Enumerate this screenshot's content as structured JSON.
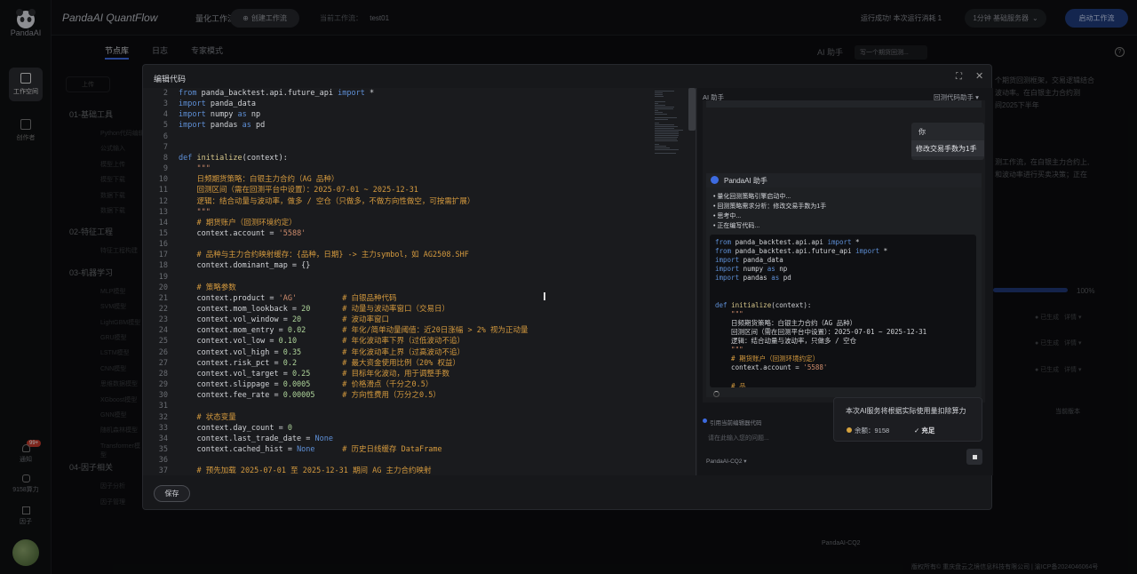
{
  "app": {
    "logo_text": "PandaAI",
    "brand": "PandaAI QuantFlow",
    "section_title": "量化工作流",
    "create_button": "创建工作流",
    "workflow_label": "当前工作流：",
    "workflow_name": "test01",
    "run_status": "运行成功! 本次运行消耗 1",
    "server": "1分钟 基础服务器",
    "start_button": "启动工作流"
  },
  "rail": {
    "workspace": "工作空间",
    "creator": "创作者",
    "notify": "通知",
    "notify_badge": "99+",
    "compute": "9158算力",
    "factor": "因子"
  },
  "tabs": [
    "节点库",
    "日志",
    "专家模式"
  ],
  "bg_side": {
    "upload": "上传",
    "groups": [
      {
        "label": "01-基础工具",
        "items": [
          "Python代码编辑",
          "公式输入",
          "模型上传",
          "模型下载",
          "数据下载",
          "数据下载"
        ]
      },
      {
        "label": "02-特征工程",
        "items": [
          "特征工程构建"
        ]
      },
      {
        "label": "03-机器学习",
        "items": [
          "MLP模型",
          "SVM模型",
          "LightGBM模型",
          "GRU模型",
          "LSTM模型",
          "CNN模型",
          "思维数据模型",
          "XGboost模型",
          "GNN模型",
          "随机森林模型",
          "Transformer模型"
        ]
      },
      {
        "label": "04-因子相关",
        "items": [
          "因子分析",
          "因子管理"
        ]
      }
    ]
  },
  "bg_right": {
    "ai_title": "AI 助手",
    "ai_tab": "写一个期货回测...",
    "lines": [
      "个期货回测框架，交易逻辑结合",
      "波动率。在白银主力合约测",
      "间2025下半年"
    ],
    "lines2": [
      "测工作流，在白银主力合约上,",
      "和波动率进行买卖决策；正在"
    ],
    "progress": "100%",
    "statuses": [
      "已生成",
      "已生成",
      "已生成"
    ],
    "details": "详情",
    "version_btn": "当前版本",
    "model_tab": "PandaAI-CQ2",
    "footer": "版权所有© 重庆盘云之境信息科技有限公司 | 渝ICP备2024046064号"
  },
  "modal": {
    "title": "编辑代码",
    "save": "保存",
    "code": [
      {
        "n": 2,
        "t": [
          [
            "kw",
            "from "
          ],
          [
            "tx",
            "panda_backtest.api.future_api "
          ],
          [
            "kw",
            "import "
          ],
          [
            "tx",
            "*"
          ]
        ]
      },
      {
        "n": 3,
        "t": [
          [
            "kw",
            "import "
          ],
          [
            "tx",
            "panda_data"
          ]
        ]
      },
      {
        "n": 4,
        "t": [
          [
            "kw",
            "import "
          ],
          [
            "tx",
            "numpy "
          ],
          [
            "kw",
            "as "
          ],
          [
            "tx",
            "np"
          ]
        ]
      },
      {
        "n": 5,
        "t": [
          [
            "kw",
            "import "
          ],
          [
            "tx",
            "pandas "
          ],
          [
            "kw",
            "as "
          ],
          [
            "tx",
            "pd"
          ]
        ]
      },
      {
        "n": 6,
        "t": []
      },
      {
        "n": 7,
        "t": []
      },
      {
        "n": 8,
        "t": [
          [
            "kw",
            "def "
          ],
          [
            "fn",
            "initialize"
          ],
          [
            "tx",
            "(context):"
          ]
        ]
      },
      {
        "n": 9,
        "t": [
          [
            "st",
            "    \"\"\""
          ]
        ]
      },
      {
        "n": 10,
        "t": [
          [
            "cm",
            "    日频期货策略：白银主力合约（AG 品种）"
          ]
        ]
      },
      {
        "n": 11,
        "t": [
          [
            "cm",
            "    回测区间（需在回测平台中设置）：2025-07-01 ~ 2025-12-31"
          ]
        ]
      },
      {
        "n": 12,
        "t": [
          [
            "cm",
            "    逻辑：结合动量与波动率，做多 / 空仓（只做多，不做方向性做空，可按需扩展）"
          ]
        ]
      },
      {
        "n": 13,
        "t": [
          [
            "st",
            "    \"\"\""
          ]
        ]
      },
      {
        "n": 14,
        "t": [
          [
            "cm",
            "    # 期货账户（回测环境约定）"
          ]
        ]
      },
      {
        "n": 15,
        "t": [
          [
            "tx",
            "    context.account = "
          ],
          [
            "st",
            "'5588'"
          ]
        ]
      },
      {
        "n": 16,
        "t": []
      },
      {
        "n": 17,
        "t": [
          [
            "cm",
            "    # 品种与主力合约映射缓存：{品种，日期} -> 主力symbol，如 AG2508.SHF"
          ]
        ]
      },
      {
        "n": 18,
        "t": [
          [
            "tx",
            "    context.dominant_map = {}"
          ]
        ]
      },
      {
        "n": 19,
        "t": []
      },
      {
        "n": 20,
        "t": [
          [
            "cm",
            "    # 策略参数"
          ]
        ]
      },
      {
        "n": 21,
        "t": [
          [
            "tx",
            "    context.product = "
          ],
          [
            "st",
            "'AG'"
          ],
          [
            "cm",
            "          # 白银品种代码"
          ]
        ]
      },
      {
        "n": 22,
        "t": [
          [
            "tx",
            "    context.mom_lookback = "
          ],
          [
            "nm",
            "20"
          ],
          [
            "cm",
            "       # 动量与波动率窗口（交易日）"
          ]
        ]
      },
      {
        "n": 23,
        "t": [
          [
            "tx",
            "    context.vol_window = "
          ],
          [
            "nm",
            "20"
          ],
          [
            "cm",
            "         # 波动率窗口"
          ]
        ]
      },
      {
        "n": 24,
        "t": [
          [
            "tx",
            "    context.mom_entry = "
          ],
          [
            "nm",
            "0.02"
          ],
          [
            "cm",
            "        # 年化/简单动量阈值：近20日涨幅 > 2% 视为正动量"
          ]
        ]
      },
      {
        "n": 25,
        "t": [
          [
            "tx",
            "    context.vol_low = "
          ],
          [
            "nm",
            "0.10"
          ],
          [
            "cm",
            "          # 年化波动率下界（过低波动不追）"
          ]
        ]
      },
      {
        "n": 26,
        "t": [
          [
            "tx",
            "    context.vol_high = "
          ],
          [
            "nm",
            "0.35"
          ],
          [
            "cm",
            "         # 年化波动率上界（过高波动不追）"
          ]
        ]
      },
      {
        "n": 27,
        "t": [
          [
            "tx",
            "    context.risk_pct = "
          ],
          [
            "nm",
            "0.2"
          ],
          [
            "cm",
            "          # 最大资金使用比例（20% 权益）"
          ]
        ]
      },
      {
        "n": 28,
        "t": [
          [
            "tx",
            "    context.vol_target = "
          ],
          [
            "nm",
            "0.25"
          ],
          [
            "cm",
            "       # 目标年化波动，用于调整手数"
          ]
        ]
      },
      {
        "n": 29,
        "t": [
          [
            "tx",
            "    context.slippage = "
          ],
          [
            "nm",
            "0.0005"
          ],
          [
            "cm",
            "       # 价格滑点（千分之0.5）"
          ]
        ]
      },
      {
        "n": 30,
        "t": [
          [
            "tx",
            "    context.fee_rate = "
          ],
          [
            "nm",
            "0.00005"
          ],
          [
            "cm",
            "      # 方向性费用（万分之0.5）"
          ]
        ]
      },
      {
        "n": 31,
        "t": []
      },
      {
        "n": 32,
        "t": [
          [
            "cm",
            "    # 状态变量"
          ]
        ]
      },
      {
        "n": 33,
        "t": [
          [
            "tx",
            "    context.day_count = "
          ],
          [
            "nm",
            "0"
          ]
        ]
      },
      {
        "n": 34,
        "t": [
          [
            "tx",
            "    context.last_trade_date = "
          ],
          [
            "kw",
            "None"
          ]
        ]
      },
      {
        "n": 35,
        "t": [
          [
            "tx",
            "    context.cached_hist = "
          ],
          [
            "kw",
            "None"
          ],
          [
            "cm",
            "      # 历史日线缓存 DataFrame"
          ]
        ]
      },
      {
        "n": 36,
        "t": []
      },
      {
        "n": 37,
        "t": [
          [
            "cm",
            "    # 预先加载 2025-07-01 至 2025-12-31 期间 AG 主力合约映射"
          ]
        ]
      }
    ]
  },
  "ai_panel": {
    "title": "AI 助手",
    "mode": "回测代码助手",
    "user_label": "你",
    "user_msg": "修改交易手数为1手",
    "assistant_name": "PandaAI 助手",
    "bullets": [
      "量化回测策略引擎启动中...",
      "回测策略需求分析：修改交易手数为1手",
      "思考中...",
      "正在编写代码..."
    ],
    "code": [
      [
        [
          "kw",
          "from "
        ],
        [
          "tx",
          "panda_backtest.api.api "
        ],
        [
          "kw",
          "import "
        ],
        [
          "tx",
          "*"
        ]
      ],
      [
        [
          "kw",
          "from "
        ],
        [
          "tx",
          "panda_backtest.api.future_api "
        ],
        [
          "kw",
          "import "
        ],
        [
          "tx",
          "*"
        ]
      ],
      [
        [
          "kw",
          "import "
        ],
        [
          "tx",
          "panda_data"
        ]
      ],
      [
        [
          "kw",
          "import "
        ],
        [
          "tx",
          "numpy "
        ],
        [
          "kw",
          "as "
        ],
        [
          "tx",
          "np"
        ]
      ],
      [
        [
          "kw",
          "import "
        ],
        [
          "tx",
          "pandas "
        ],
        [
          "kw",
          "as "
        ],
        [
          "tx",
          "pd"
        ]
      ],
      [],
      [],
      [
        [
          "kw",
          "def "
        ],
        [
          "fn",
          "initialize"
        ],
        [
          "tx",
          "(context):"
        ]
      ],
      [
        [
          "st",
          "    \"\"\""
        ]
      ],
      [
        [
          "tx",
          "    日频期货策略：白银主力合约（AG 品种）"
        ]
      ],
      [
        [
          "tx",
          "    回测区间（需在回测平台中设置）：2025-07-01 ~ 2025-12-31"
        ]
      ],
      [
        [
          "tx",
          "    逻辑：结合动量与波动率，只做多 / 空仓"
        ]
      ],
      [
        [
          "st",
          "    \"\"\""
        ]
      ],
      [
        [
          "cm",
          "    # 期货账户（回测环境约定）"
        ]
      ],
      [
        [
          "tx",
          "    context.account = "
        ],
        [
          "st",
          "'5588'"
        ]
      ],
      [],
      [
        [
          "cm",
          "    # 品"
        ]
      ]
    ],
    "ref_code": "引用当前编辑器代码",
    "input_placeholder": "请在此输入您的问题...",
    "model": "PandaAI-CQ2",
    "popover_text": "本次AI服务将根据实际使用量扣除算力",
    "balance_label": "余额：9158",
    "recharge": "充足"
  }
}
